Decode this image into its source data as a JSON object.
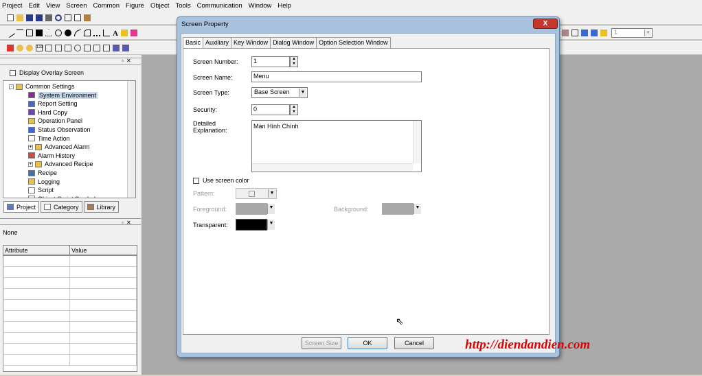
{
  "menu": [
    "Project",
    "Edit",
    "View",
    "Screen",
    "Common",
    "Figure",
    "Object",
    "Tools",
    "Communication",
    "Window",
    "Help"
  ],
  "toolbar": {
    "zoom_value": "1"
  },
  "left_pane": {
    "overlay_checkbox_label": "Display Overlay Screen",
    "tree": [
      {
        "label": "Common Settings",
        "level": 0,
        "expander": "-",
        "icon": "folder-icon"
      },
      {
        "label": "System Environment",
        "level": 1,
        "icon": "system-environment-icon",
        "selected": true
      },
      {
        "label": "Report Setting",
        "level": 1,
        "icon": "report-icon"
      },
      {
        "label": "Hard Copy",
        "level": 1,
        "icon": "printer-icon"
      },
      {
        "label": "Operation Panel",
        "level": 1,
        "icon": "panel-icon"
      },
      {
        "label": "Status Observation",
        "level": 1,
        "icon": "status-icon"
      },
      {
        "label": "Time Action",
        "level": 1,
        "icon": "clock-icon"
      },
      {
        "label": "Advanced Alarm",
        "level": 1,
        "expander": "+",
        "icon": "folder-icon"
      },
      {
        "label": "Alarm History",
        "level": 1,
        "icon": "alarm-icon"
      },
      {
        "label": "Advanced Recipe",
        "level": 1,
        "expander": "+",
        "icon": "folder-icon"
      },
      {
        "label": "Recipe",
        "level": 1,
        "icon": "recipe-icon"
      },
      {
        "label": "Logging",
        "level": 1,
        "icon": "logging-icon"
      },
      {
        "label": "Script",
        "level": 1,
        "icon": "script-icon"
      },
      {
        "label": "Object Script Symbol",
        "level": 1,
        "icon": "script-icon"
      }
    ],
    "tabs": [
      "Project",
      "Category",
      "Library"
    ],
    "property_selection": "None",
    "attr_headers": [
      "Attribute",
      "Value"
    ]
  },
  "dialog": {
    "title": "Screen Property",
    "close_label": "X",
    "tabs": [
      "Basic",
      "Auxiliary",
      "Key Window",
      "Dialog Window",
      "Option Selection Window"
    ],
    "screen_number_label": "Screen Number:",
    "screen_number": "1",
    "screen_name_label": "Screen Name:",
    "screen_name": "Menu",
    "screen_type_label": "Screen Type:",
    "screen_type": "Base Screen",
    "security_label": "Security:",
    "security": "0",
    "explanation_label_1": "Detailed",
    "explanation_label_2": "Explanation:",
    "explanation": "Màn Hình Chính",
    "use_screen_color_label": "Use screen color",
    "pattern_label": "Pattern:",
    "foreground_label": "Foreground:",
    "background_label": "Background:",
    "transparent_label": "Transparent:",
    "btn_screen_size": "Screen Size",
    "btn_ok": "OK",
    "btn_cancel": "Cancel",
    "colors": {
      "foreground": "#a8a8a8",
      "background": "#a8a8a8",
      "transparent": "#000000"
    }
  },
  "watermark": "http://diendandien.com"
}
